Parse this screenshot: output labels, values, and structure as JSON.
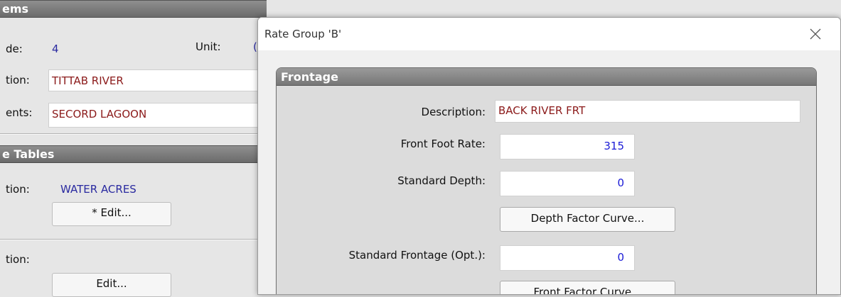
{
  "background": {
    "items_header": "ems",
    "code_label": "de:",
    "code_value": "4",
    "unit_label": "Unit:",
    "unit_value": "(",
    "location_label": "tion:",
    "location_value": "TITTAB RIVER",
    "comments_label": "ents:",
    "comments_value": "SECORD LAGOON",
    "tables_header": "e Tables",
    "table1_label": "tion:",
    "table1_value": "WATER ACRES",
    "table1_edit": "* Edit...",
    "table2_label": "tion:",
    "table2_edit": "Edit..."
  },
  "dialog": {
    "title": "Rate Group 'B'",
    "group_header": "Frontage",
    "description_label": "Description:",
    "description_value": "BACK RIVER FRT",
    "ffr_label": "Front Foot Rate:",
    "ffr_value": "315",
    "std_depth_label": "Standard Depth:",
    "std_depth_value": "0",
    "depth_curve_button": "Depth Factor Curve...",
    "std_frontage_label": "Standard Frontage (Opt.):",
    "std_frontage_value": "0",
    "front_curve_button": "Front Factor Curve..."
  },
  "colors": {
    "text_value": "#8b1a1a",
    "numeric_value": "#1a1ad6",
    "link_value": "#2a2aa0"
  }
}
